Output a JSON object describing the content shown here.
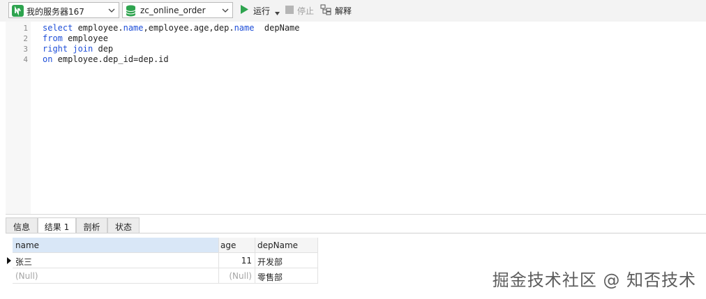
{
  "toolbar": {
    "connection": "我的服务器167",
    "database": "zc_online_order",
    "run_label": "运行",
    "stop_label": "停止",
    "explain_label": "解释"
  },
  "editor": {
    "line_numbers": [
      "1",
      "2",
      "3",
      "4"
    ],
    "lines": [
      [
        "select",
        " employee.",
        "name",
        ",employee.age,dep.",
        "name",
        "  depName"
      ],
      [
        "from",
        " employee"
      ],
      [
        "right join",
        " dep"
      ],
      [
        "on",
        " employee.dep_id=dep.id"
      ]
    ]
  },
  "result_tabs": [
    "信息",
    "结果 1",
    "剖析",
    "状态"
  ],
  "active_tab": "结果 1",
  "table": {
    "columns": [
      "name",
      "age",
      "depName"
    ],
    "rows": [
      [
        "张三",
        "11",
        "开发部"
      ],
      [
        "(Null)",
        "(Null)",
        "零售部"
      ]
    ]
  },
  "watermark": "掘金技术社区 @ 知否技术",
  "colors": {
    "keyword": "#1f4fd8",
    "run_green": "#2ea44f",
    "selected_header": "#d9e7f7",
    "null_text": "#a5a5a5"
  }
}
